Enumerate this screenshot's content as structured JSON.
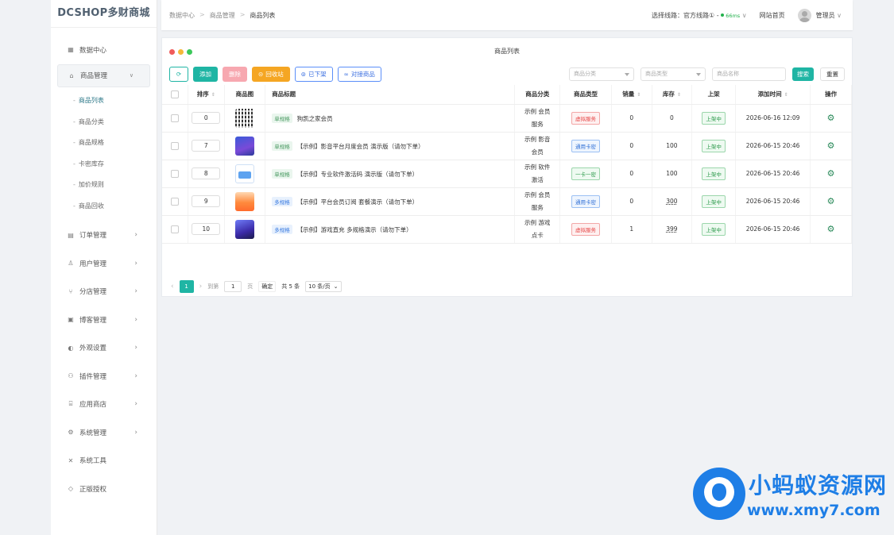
{
  "brand": "DCSHOP多财商城",
  "breadcrumb": [
    "数据中心",
    "商品管理",
    "商品列表"
  ],
  "topbar": {
    "route_label": "选择线路：官方线路①",
    "route_sep": "-",
    "latency": "66ms",
    "site_home": "网站首页",
    "user": "管理员"
  },
  "sidebar": {
    "items": [
      {
        "label": "数据中心",
        "icon": "grid-icon",
        "arrow": ""
      },
      {
        "label": "商品管理",
        "icon": "bag-icon",
        "arrow": "⌄",
        "open": true
      },
      {
        "label": "订单管理",
        "icon": "doc-icon",
        "arrow": "›"
      },
      {
        "label": "用户管理",
        "icon": "user-icon",
        "arrow": "›"
      },
      {
        "label": "分店管理",
        "icon": "branch-icon",
        "arrow": "›"
      },
      {
        "label": "博客管理",
        "icon": "book-icon",
        "arrow": "›"
      },
      {
        "label": "外观设置",
        "icon": "palette-icon",
        "arrow": "›"
      },
      {
        "label": "插件管理",
        "icon": "plug-icon",
        "arrow": "›"
      },
      {
        "label": "应用商店",
        "icon": "store-icon",
        "arrow": "›"
      },
      {
        "label": "系统管理",
        "icon": "gear-icon",
        "arrow": "›"
      },
      {
        "label": "系统工具",
        "icon": "tools-icon",
        "arrow": ""
      },
      {
        "label": "正版授权",
        "icon": "shield-icon",
        "arrow": ""
      }
    ],
    "submenu": [
      "商品列表",
      "商品分类",
      "商品规格",
      "卡密库存",
      "加价规则",
      "商品回收"
    ]
  },
  "panel_title": "商品列表",
  "toolbar": {
    "refresh": "⟳",
    "add": "添加",
    "delete": "删除",
    "recycle": "回收站",
    "off_shelf": "已下架",
    "dock": "对接商品",
    "filter_category": "商品分类",
    "filter_type": "商品类型",
    "filter_name": "商品名称",
    "search": "搜索",
    "reset": "重置"
  },
  "table": {
    "headers": [
      "排序",
      "商品图",
      "商品标题",
      "商品分类",
      "商品类型",
      "销量",
      "库存",
      "上架",
      "添加时间",
      "操作"
    ],
    "rows": [
      {
        "sort": "0",
        "thumb": "qr",
        "spec": "单规格",
        "title": "狗凯之家会员",
        "category": [
          "示例 会员",
          "服务"
        ],
        "type": "虚拟服务",
        "sales": "0",
        "stock": "0",
        "status": "上架中",
        "time": "2026-06-16 12:09"
      },
      {
        "sort": "7",
        "thumb": "blue",
        "spec": "单规格",
        "title": "【示例】影音平台月度会员 演示版（请勿下单）",
        "category": [
          "示例 影音",
          "会员"
        ],
        "type": "通用卡密",
        "sales": "0",
        "stock": "100",
        "status": "上架中",
        "time": "2026-06-15 20:46"
      },
      {
        "sort": "8",
        "thumb": "card",
        "spec": "单规格",
        "title": "【示例】专业软件激活码 演示版（请勿下单）",
        "category": [
          "示例 软件",
          "激活"
        ],
        "type": "一卡一密",
        "sales": "0",
        "stock": "100",
        "status": "上架中",
        "time": "2026-06-15 20:46"
      },
      {
        "sort": "9",
        "thumb": "orange",
        "spec": "多规格",
        "title": "【示例】平台会员订阅 套餐演示（请勿下单）",
        "category": [
          "示例 会员",
          "服务"
        ],
        "type": "通用卡密",
        "sales": "0",
        "stock": "300",
        "status": "上架中",
        "time": "2026-06-15 20:46"
      },
      {
        "sort": "10",
        "thumb": "dark",
        "spec": "多规格",
        "title": "【示例】游戏直充 多规格演示（请勿下单）",
        "category": [
          "示例 游戏",
          "点卡"
        ],
        "type": "虚拟服务",
        "sales": "1",
        "stock": "399",
        "status": "上架中",
        "time": "2026-06-15 20:46"
      }
    ]
  },
  "pager": {
    "prev": "‹",
    "current": "1",
    "next": "›",
    "goto_label": "到第",
    "goto_value": "1",
    "page_unit": "页",
    "confirm": "确定",
    "total": "共 5 条",
    "page_size": "10 条/页"
  },
  "watermark": {
    "title": "小蚂蚁资源网",
    "url": "www.xmy7.com"
  },
  "colors": {
    "accent": "#1fb5a4",
    "danger": "#f7a8b0",
    "warning": "#f5a623",
    "watermark": "#1e7ee6"
  }
}
